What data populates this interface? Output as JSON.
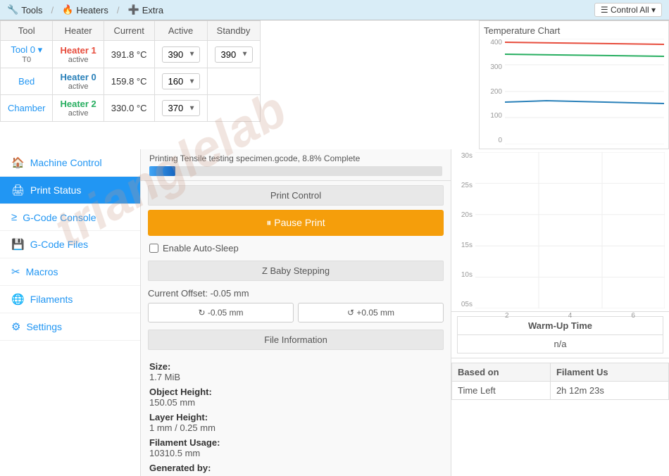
{
  "toolbar": {
    "tabs": [
      {
        "label": "Tools",
        "icon": "🔧"
      },
      {
        "label": "Heaters",
        "icon": "🔥"
      },
      {
        "label": "Extra",
        "icon": "➕"
      }
    ],
    "control_all_label": "☰ Control All ▾"
  },
  "heater_table": {
    "headers": [
      "Tool",
      "Heater",
      "Current",
      "Active",
      "Standby"
    ],
    "rows": [
      {
        "tool": "Tool 0 ▾",
        "tool_sub": "T0",
        "heater_name": "Heater 1",
        "heater_color": "red",
        "heater_sub": "active",
        "current": "391.8 °C",
        "active_val": "390",
        "standby_val": "390"
      },
      {
        "tool": "Bed",
        "tool_sub": "",
        "heater_name": "Heater 0",
        "heater_color": "blue",
        "heater_sub": "active",
        "current": "159.8 °C",
        "active_val": "160",
        "standby_val": ""
      },
      {
        "tool": "Chamber",
        "tool_sub": "",
        "heater_name": "Heater 2",
        "heater_color": "green",
        "heater_sub": "active",
        "current": "330.0 °C",
        "active_val": "370",
        "standby_val": ""
      }
    ]
  },
  "temp_chart": {
    "title": "Temperature Chart",
    "y_labels": [
      "400",
      "300",
      "200",
      "100",
      "0"
    ]
  },
  "sidebar": {
    "items": [
      {
        "label": "Machine Control",
        "icon": "🏠",
        "active": false
      },
      {
        "label": "Print Status",
        "icon": "🖨",
        "active": true
      },
      {
        "label": "G-Code Console",
        "icon": "≥",
        "active": false
      },
      {
        "label": "G-Code Files",
        "icon": "💾",
        "active": false
      },
      {
        "label": "Macros",
        "icon": "✂",
        "active": false
      },
      {
        "label": "Filaments",
        "icon": "🌐",
        "active": false
      },
      {
        "label": "Settings",
        "icon": "⚙",
        "active": false
      }
    ]
  },
  "print_status": {
    "file_name": "Printing Tensile testing specimen.gcode, 8.8% Complete",
    "progress_pct": 8.8
  },
  "print_control": {
    "section_title": "Print Control",
    "pause_btn_label": "⏸ Pause Print",
    "auto_sleep_label": "Enable Auto-Sleep"
  },
  "z_stepping": {
    "section_title": "Z Baby Stepping",
    "current_offset_label": "Current Offset: -0.05 mm",
    "btn_minus": "↻ -0.05 mm",
    "btn_plus": "↺ +0.05 mm"
  },
  "file_info": {
    "section_title": "File Information",
    "size_label": "Size:",
    "size_value": "1.7 MiB",
    "object_height_label": "Object Height:",
    "object_height_value": "150.05 mm",
    "layer_height_label": "Layer Height:",
    "layer_height_value": "1 mm / 0.25 mm",
    "filament_usage_label": "Filament Usage:",
    "filament_usage_value": "10310.5 mm",
    "generated_by_label": "Generated by:"
  },
  "right_chart": {
    "y_labels": [
      "30s",
      "25s",
      "20s",
      "15s",
      "10s",
      "05s"
    ],
    "x_labels": [
      "2",
      "4",
      "6"
    ]
  },
  "warm_up": {
    "title": "Warm-Up Time",
    "value": "n/a"
  },
  "based_on_table": {
    "headers": [
      "Based on",
      "Filament Us"
    ],
    "rows": [
      [
        "Time Left",
        "2h 12m 23s"
      ]
    ]
  }
}
